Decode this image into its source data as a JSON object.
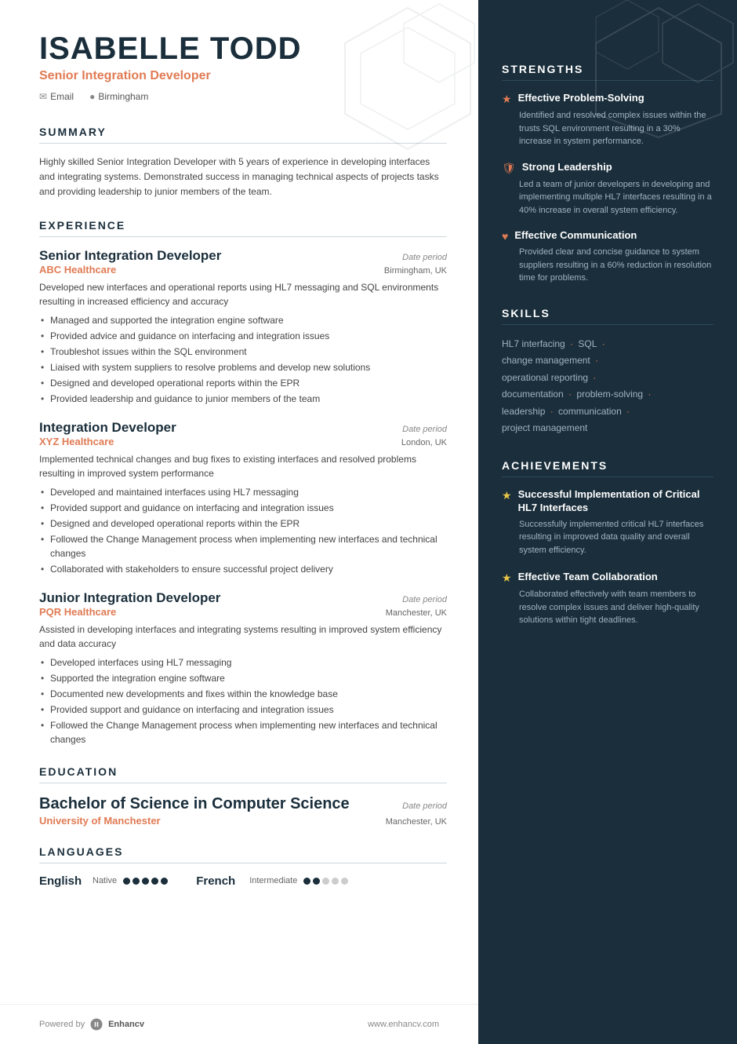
{
  "header": {
    "name": "ISABELLE TODD",
    "title": "Senior Integration Developer",
    "contact": {
      "email_label": "Email",
      "location": "Birmingham"
    }
  },
  "summary": {
    "section_title": "SUMMARY",
    "text": "Highly skilled Senior Integration Developer with 5 years of experience in developing interfaces and integrating systems. Demonstrated success in managing technical aspects of projects tasks and providing leadership to junior members of the team."
  },
  "experience": {
    "section_title": "EXPERIENCE",
    "jobs": [
      {
        "role": "Senior Integration Developer",
        "date": "Date period",
        "company": "ABC Healthcare",
        "location": "Birmingham, UK",
        "description": "Developed new interfaces and operational reports using HL7 messaging and SQL environments resulting in increased efficiency and accuracy",
        "bullets": [
          "Managed and supported the integration engine software",
          "Provided advice and guidance on interfacing and integration issues",
          "Troubleshot issues within the SQL environment",
          "Liaised with system suppliers to resolve problems and develop new solutions",
          "Designed and developed operational reports within the EPR",
          "Provided leadership and guidance to junior members of the team"
        ]
      },
      {
        "role": "Integration Developer",
        "date": "Date period",
        "company": "XYZ Healthcare",
        "location": "London, UK",
        "description": "Implemented technical changes and bug fixes to existing interfaces and resolved problems resulting in improved system performance",
        "bullets": [
          "Developed and maintained interfaces using HL7 messaging",
          "Provided support and guidance on interfacing and integration issues",
          "Designed and developed operational reports within the EPR",
          "Followed the Change Management process when implementing new interfaces and technical changes",
          "Collaborated with stakeholders to ensure successful project delivery"
        ]
      },
      {
        "role": "Junior Integration Developer",
        "date": "Date period",
        "company": "PQR Healthcare",
        "location": "Manchester, UK",
        "description": "Assisted in developing interfaces and integrating systems resulting in improved system efficiency and data accuracy",
        "bullets": [
          "Developed interfaces using HL7 messaging",
          "Supported the integration engine software",
          "Documented new developments and fixes within the knowledge base",
          "Provided support and guidance on interfacing and integration issues",
          "Followed the Change Management process when implementing new interfaces and technical changes"
        ]
      }
    ]
  },
  "education": {
    "section_title": "EDUCATION",
    "degree": "Bachelor of Science in Computer Science",
    "date": "Date period",
    "school": "University of Manchester",
    "location": "Manchester, UK"
  },
  "languages": {
    "section_title": "LANGUAGES",
    "items": [
      {
        "name": "English",
        "level": "Native",
        "dots_filled": 5,
        "dots_total": 5
      },
      {
        "name": "French",
        "level": "Intermediate",
        "dots_filled": 2,
        "dots_total": 5
      }
    ]
  },
  "footer": {
    "powered_by": "Powered by",
    "brand": "Enhancv",
    "website": "www.enhancv.com"
  },
  "strengths": {
    "section_title": "STRENGTHS",
    "items": [
      {
        "icon": "star-outline",
        "name": "Effective Problem-Solving",
        "desc": "Identified and resolved complex issues within the trusts SQL environment resulting in a 30% increase in system performance."
      },
      {
        "icon": "shield",
        "name": "Strong Leadership",
        "desc": "Led a team of junior developers in developing and implementing multiple HL7 interfaces resulting in a 40% increase in overall system efficiency."
      },
      {
        "icon": "heart",
        "name": "Effective Communication",
        "desc": "Provided clear and concise guidance to system suppliers resulting in a 60% reduction in resolution time for problems."
      }
    ]
  },
  "skills": {
    "section_title": "SKILLS",
    "items": [
      "HL7 interfacing",
      "SQL",
      "change management",
      "operational reporting",
      "documentation",
      "problem-solving",
      "leadership",
      "communication",
      "project management"
    ]
  },
  "achievements": {
    "section_title": "ACHIEVEMENTS",
    "items": [
      {
        "icon": "star",
        "name": "Successful Implementation of Critical HL7 Interfaces",
        "desc": "Successfully implemented critical HL7 interfaces resulting in improved data quality and overall system efficiency."
      },
      {
        "icon": "star",
        "name": "Effective Team Collaboration",
        "desc": "Collaborated effectively with team members to resolve complex issues and deliver high-quality solutions within tight deadlines."
      }
    ]
  }
}
